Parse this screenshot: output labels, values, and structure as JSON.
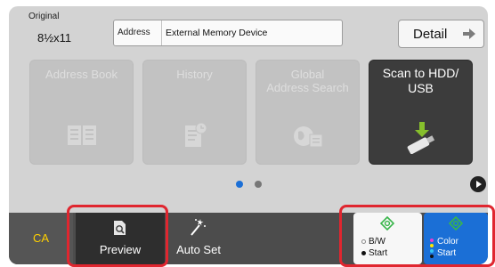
{
  "original": {
    "label": "Original",
    "value": "8½x11"
  },
  "address": {
    "label": "Address",
    "value": "External Memory Device"
  },
  "detail": {
    "label": "Detail"
  },
  "tiles": [
    {
      "label": "Address Book",
      "icon": "address-book-icon",
      "enabled": false
    },
    {
      "label": "History",
      "icon": "history-icon",
      "enabled": false
    },
    {
      "label": "Global\nAddress Search",
      "icon": "global-address-search-icon",
      "enabled": false
    },
    {
      "label": "Scan to HDD/\nUSB",
      "icon": "usb-drive-icon",
      "enabled": true
    }
  ],
  "pagination": {
    "current": 1,
    "total": 2
  },
  "bottom_bar": {
    "ca": "CA",
    "preview": "Preview",
    "auto_set": "Auto Set",
    "bw_start": {
      "line1": "B/W",
      "line2": "Start"
    },
    "color_start": {
      "line1": "Color",
      "line2": "Start"
    }
  },
  "colors": {
    "highlight": "#e0262f",
    "start_color": "#1b6fd6",
    "ca_text": "#ffd000",
    "diamond": "#39b54a",
    "arrow": "#86bf2c"
  }
}
